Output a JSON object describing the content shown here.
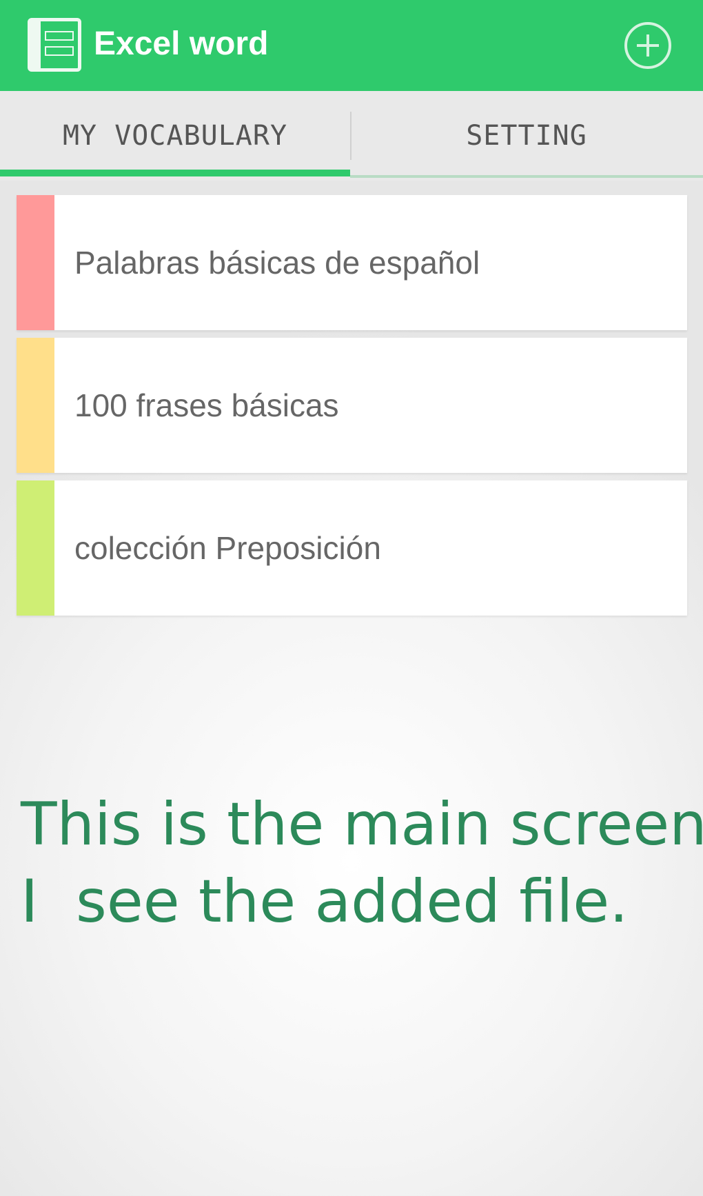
{
  "app_bar": {
    "title": "Excel word",
    "icon": "spreadsheet-app-icon",
    "action_icon": "add-circle-icon",
    "color": "#2fca6c"
  },
  "tabs": [
    {
      "label": "MY VOCABULARY",
      "active": true
    },
    {
      "label": "SETTING",
      "active": false
    }
  ],
  "vocab_list": [
    {
      "title": "Palabras básicas de español",
      "color": "#ff9999"
    },
    {
      "title": "100 frases básicas",
      "color": "#ffdf8a"
    },
    {
      "title": "colección Preposición",
      "color": "#cfee74"
    }
  ],
  "caption": {
    "line1": "This is the main screen.",
    "line2": "I  see the added file."
  }
}
